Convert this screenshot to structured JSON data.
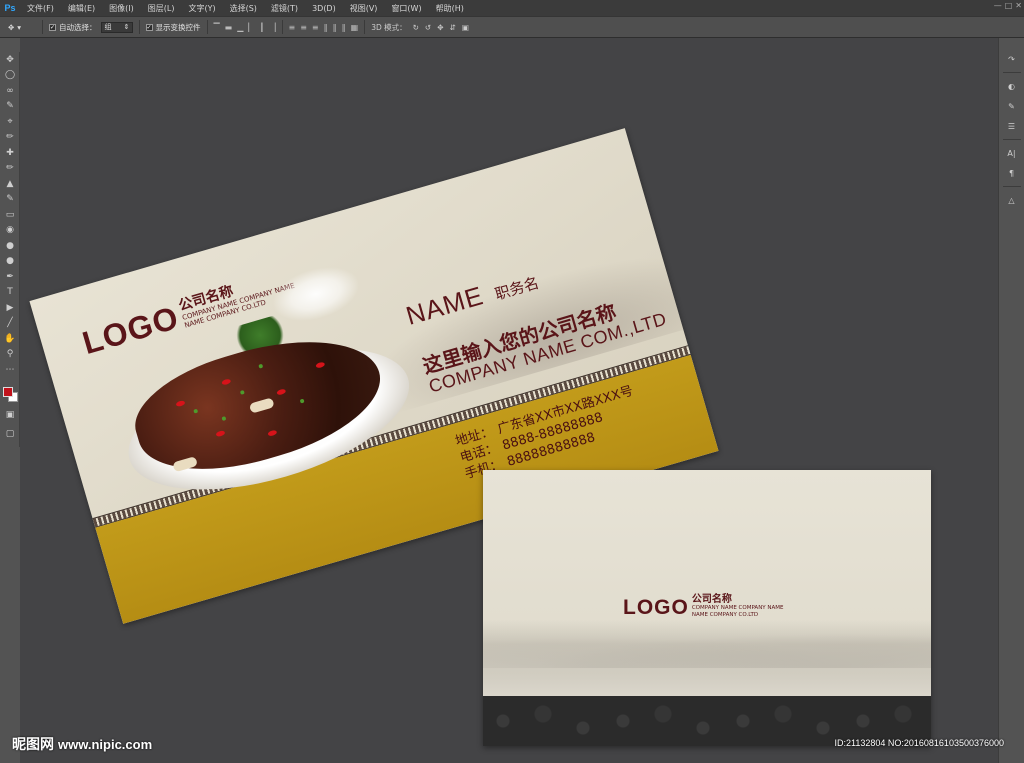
{
  "menubar": {
    "app_logo": "Ps",
    "items": [
      "文件(F)",
      "编辑(E)",
      "图像(I)",
      "图层(L)",
      "文字(Y)",
      "选择(S)",
      "滤镜(T)",
      "3D(D)",
      "视图(V)",
      "窗口(W)",
      "帮助(H)"
    ]
  },
  "options_bar": {
    "tool_icon": "move-tool-icon",
    "auto_select_label": "自动选择：",
    "auto_select_value": "组",
    "show_transform_label": "显示变换控件",
    "mode_3d_label": "3D 模式："
  },
  "front_card": {
    "logo": "LOGO",
    "company_cn": "公司名称",
    "company_en_line1": "COMPANY NAME COMPANY NAME",
    "company_en_line2": "NAME COMPANY CO.LTD",
    "name": "NAME",
    "job_title": "职务名",
    "company_headline_cn": "这里输入您的公司名称",
    "company_headline_en": "COMPANY NAME COM.,LTD",
    "contacts": [
      {
        "label": "地址：",
        "value": "广东省XX市XX路XXX号"
      },
      {
        "label": "电话：",
        "value": "8888-88888888"
      },
      {
        "label": "手机：",
        "value": "88888888888"
      }
    ],
    "colors": {
      "accent": "#5a1519",
      "gold": "#b58d14",
      "paper": "#e8e3d4"
    }
  },
  "back_card": {
    "logo": "LOGO",
    "company_cn": "公司名称",
    "company_en_line1": "COMPANY NAME COMPANY NAME",
    "company_en_line2": "NAME COMPANY CO.LTD"
  },
  "watermark": {
    "left_brand": "昵图网",
    "left_site": "www.nipic.com",
    "right_id": "ID:21132804 NO:20160816103500376000"
  }
}
